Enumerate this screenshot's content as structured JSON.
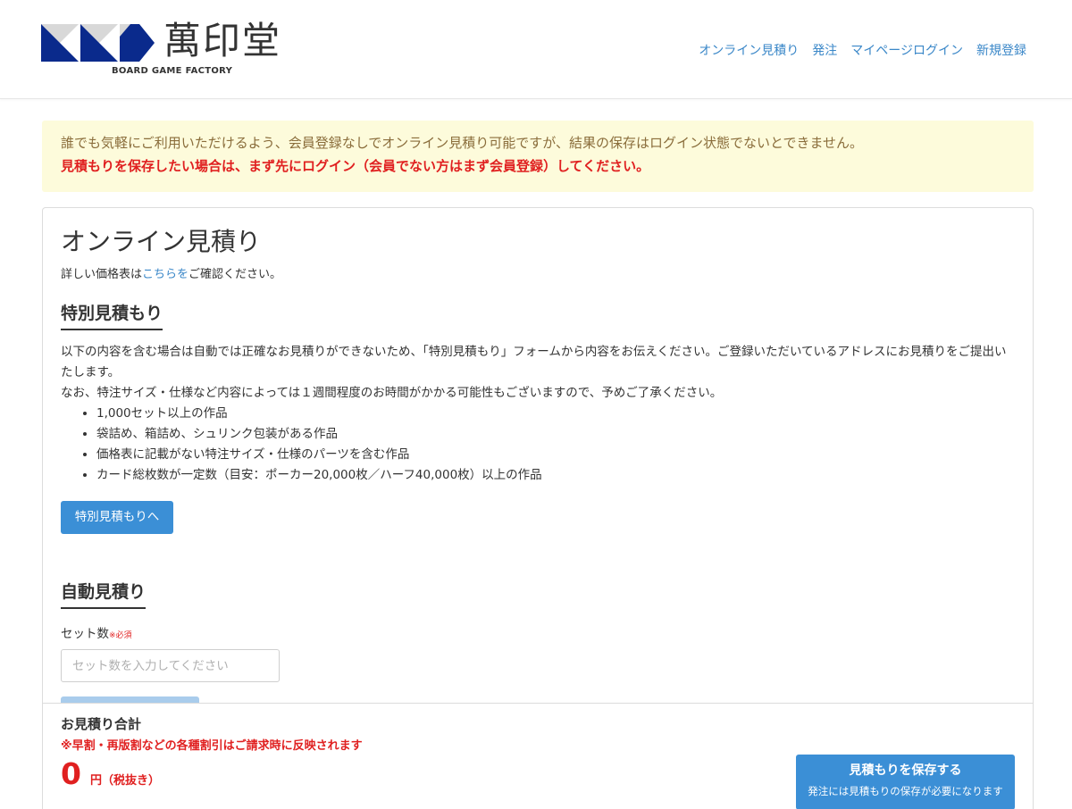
{
  "brand": {
    "kanji": "萬印堂",
    "subtitle": "BOARD GAME FACTORY",
    "colors": {
      "dark_blue": "#0a2a8c",
      "gray": "#d8d8d8"
    }
  },
  "nav": {
    "items": [
      "オンライン見積り",
      "発注",
      "マイページログイン",
      "新規登録"
    ]
  },
  "notice": {
    "line1": "誰でも気軽にご利用いただけるよう、会員登録なしでオンライン見積り可能ですが、結果の保存はログイン状態でないとできません。",
    "line2": "見積もりを保存したい場合は、まず先にログイン（会員でない方はまず会員登録）してください。"
  },
  "main": {
    "title": "オンライン見積り",
    "price_note_prefix": "詳しい価格表は",
    "price_note_link": "こちらを",
    "price_note_suffix": "ご確認ください。",
    "special": {
      "heading": "特別見積もり",
      "desc1": "以下の内容を含む場合は自動では正確なお見積りができないため、「特別見積もり」フォームから内容をお伝えください。ご登録いただいているアドレスにお見積りをご提出いたします。",
      "desc2": "なお、特注サイズ・仕様など内容によっては１週間程度のお時間がかかる可能性もございますので、予めご了承ください。",
      "bullets": [
        "1,000セット以上の作品",
        "袋詰め、箱詰め、シュリンク包装がある作品",
        "価格表に記載がない特注サイズ・仕様のパーツを含む作品",
        "カード総枚数が一定数（目安：ポーカー20,000枚／ハーフ40,000枚）以上の作品"
      ],
      "button": "特別見積もりへ"
    },
    "auto": {
      "heading": "自動見積り",
      "field_label": "セット数",
      "required": "※必須",
      "placeholder": "セット数を入力してください"
    }
  },
  "total": {
    "title": "お見積り合計",
    "note": "※早割・再版割などの各種割引はご請求時に反映されます",
    "amount": "0",
    "unit": "円（税抜き）",
    "save_button": "見積もりを保存する",
    "save_sub": "発注には見積もりの保存が必要になります"
  }
}
